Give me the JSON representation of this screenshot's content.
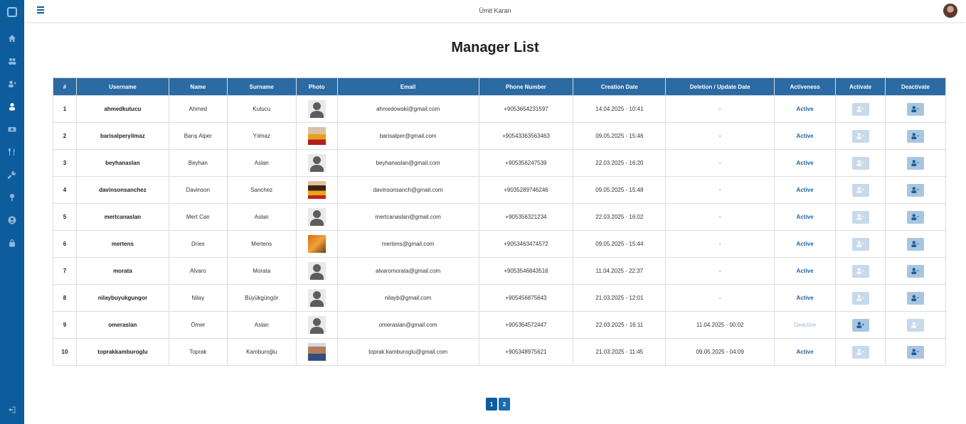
{
  "topbar": {
    "user_name": "Ümit Karan"
  },
  "page": {
    "title": "Manager List"
  },
  "sidebar": {
    "icons": [
      "home-icon",
      "users-icon",
      "user-plus-icon",
      "user-icon",
      "money-icon",
      "restaurant-icon",
      "wrench-icon",
      "location-pin-icon",
      "user-circle-icon",
      "lock-icon",
      "logout-icon"
    ]
  },
  "table": {
    "headers": [
      "#",
      "Username",
      "Name",
      "Surname",
      "Photo",
      "Email",
      "Phone Number",
      "Creation Date",
      "Deletion / Update Date",
      "Activeness",
      "Activate",
      "Deactivate"
    ],
    "rows": [
      {
        "no": "1",
        "username": "ahmedkutucu",
        "name": "Ahmed",
        "surname": "Kutucu",
        "photo": "default",
        "email": "ahmedowski@gmail.com",
        "phone": "+9053654231597",
        "created": "14.04.2025 - 10:41",
        "updated": "-",
        "status": "Active",
        "active": true
      },
      {
        "no": "2",
        "username": "barisalperyilmaz",
        "name": "Barış Alper",
        "surname": "Yılmaz",
        "photo": "p1",
        "email": "barisalper@gmail.com",
        "phone": "+90543363563463",
        "created": "09.05.2025 - 15:46",
        "updated": "-",
        "status": "Active",
        "active": true
      },
      {
        "no": "3",
        "username": "beyhanaslan",
        "name": "Beyhan",
        "surname": "Aslan",
        "photo": "default",
        "email": "beyhanaslan@gmail.com",
        "phone": "+905356247539",
        "created": "22.03.2025 - 16:20",
        "updated": "-",
        "status": "Active",
        "active": true
      },
      {
        "no": "4",
        "username": "davinsonsanchez",
        "name": "Davinson",
        "surname": "Sanchez",
        "photo": "p2",
        "email": "davinsonsanch@gmail.com",
        "phone": "+9035289746246",
        "created": "09.05.2025 - 15:48",
        "updated": "-",
        "status": "Active",
        "active": true
      },
      {
        "no": "5",
        "username": "mertcanaslan",
        "name": "Mert Can",
        "surname": "Aslan",
        "photo": "default",
        "email": "mertcanaslan@gmail.com",
        "phone": "+905356321234",
        "created": "22.03.2025 - 16:02",
        "updated": "-",
        "status": "Active",
        "active": true
      },
      {
        "no": "6",
        "username": "mertens",
        "name": "Dries",
        "surname": "Mertens",
        "photo": "p3",
        "email": "mertens@gmail.com",
        "phone": "+9053463474572",
        "created": "09.05.2025 - 15:44",
        "updated": "-",
        "status": "Active",
        "active": true
      },
      {
        "no": "7",
        "username": "morata",
        "name": "Alvaro",
        "surname": "Morata",
        "photo": "default",
        "email": "alvaromorata@gmail.com",
        "phone": "+9053546843516",
        "created": "11.04.2025 - 22:37",
        "updated": "-",
        "status": "Active",
        "active": true
      },
      {
        "no": "8",
        "username": "nilaybuyukgungor",
        "name": "Nilay",
        "surname": "Büyükgüngör",
        "photo": "default",
        "email": "nilayb@gmail.com",
        "phone": "+905456875643",
        "created": "21.03.2025 - 12:01",
        "updated": "-",
        "status": "Active",
        "active": true
      },
      {
        "no": "9",
        "username": "omeraslan",
        "name": "Ömer",
        "surname": "Aslan",
        "photo": "default",
        "email": "omeraslan@gmail.com",
        "phone": "+905364572447",
        "created": "22.03.2025 - 16:11",
        "updated": "11.04.2025 - 00:02",
        "status": "Deactive",
        "active": false
      },
      {
        "no": "10",
        "username": "toprakkamburoglu",
        "name": "Toprak",
        "surname": "Kamburoğlu",
        "photo": "p4",
        "email": "toprak.kamburoglu@gmail.com",
        "phone": "+905348975621",
        "created": "21.03.2025 - 11:45",
        "updated": "09.05.2025 - 04:09",
        "status": "Active",
        "active": true
      }
    ]
  },
  "pagination": {
    "pages": [
      "1",
      "2"
    ],
    "current": "2"
  },
  "colors": {
    "sidebar": "#0d5c9c",
    "header": "#2b6aa3",
    "active_text": "#1e64a4"
  }
}
